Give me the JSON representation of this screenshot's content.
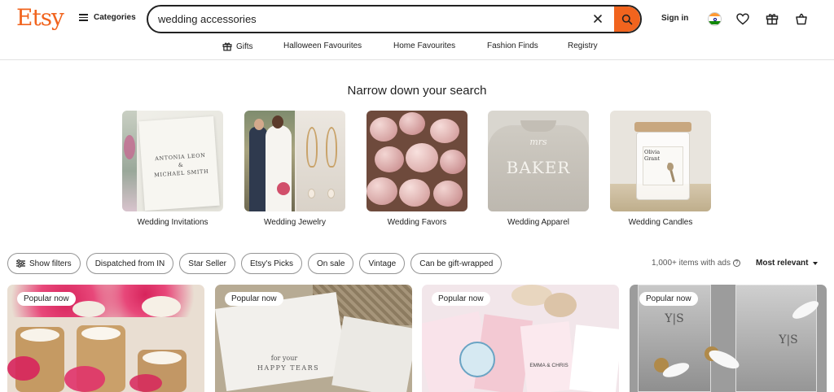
{
  "header": {
    "logo": "Etsy",
    "categories_label": "Categories",
    "search": {
      "value": "wedding accessories"
    },
    "signin_label": "Sign in"
  },
  "subnav": {
    "items": [
      {
        "label": "Gifts",
        "icon": "gift-icon"
      },
      {
        "label": "Halloween Favourites"
      },
      {
        "label": "Home Favourites"
      },
      {
        "label": "Fashion Finds"
      },
      {
        "label": "Registry"
      }
    ]
  },
  "narrow": {
    "title": "Narrow down your search",
    "categories": [
      {
        "label": "Wedding Invitations",
        "invite_line1": "ANTONIA LEON",
        "invite_amp": "&",
        "invite_line2": "MICHAEL SMITH"
      },
      {
        "label": "Wedding Jewelry"
      },
      {
        "label": "Wedding Favors"
      },
      {
        "label": "Wedding Apparel",
        "sweater_script": "mrs",
        "sweater_text": "BAKER"
      },
      {
        "label": "Wedding Candles",
        "candle_name1": "Olivia",
        "candle_name2": "Grant"
      }
    ]
  },
  "filters": {
    "show_filters": "Show filters",
    "pills": [
      "Dispatched from IN",
      "Star Seller",
      "Etsy's Picks",
      "On sale",
      "Vintage",
      "Can be gift-wrapped"
    ],
    "results_text": "1,000+ items with ads",
    "sort_label": "Most relevant"
  },
  "products": [
    {
      "badge": "Popular now"
    },
    {
      "badge": "Popular now",
      "card_text1": "for your",
      "card_text2": "HAPPY TEARS"
    },
    {
      "badge": "Popular now",
      "label_text": "EMMA & CHRIS"
    },
    {
      "badge": "Popular now",
      "bottle_text": "Y|S"
    }
  ],
  "colors": {
    "brand": "#f1641e",
    "text": "#222222",
    "muted": "#595959",
    "border": "#949494"
  }
}
